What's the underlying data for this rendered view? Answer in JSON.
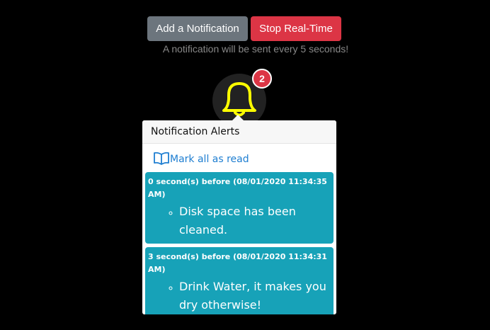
{
  "toolbar": {
    "add_label": "Add a Notification",
    "stop_label": "Stop Real-Time",
    "hint": "A notification will be sent every 5 seconds!"
  },
  "bell": {
    "icon": "bell-icon",
    "badge_count": "2",
    "colors": {
      "bell": "#ffff00",
      "badge": "#dc3545"
    }
  },
  "panel": {
    "title": "Notification Alerts",
    "mark_all_label": "Mark all as read",
    "mark_all_icon": "open-book-icon",
    "notifications": [
      {
        "time": "0 second(s) before (08/01/2020 11:34:35 AM)",
        "message": "Disk space has been cleaned."
      },
      {
        "time": "3 second(s) before (08/01/2020 11:34:31 AM)",
        "message": "Drink Water, it makes you dry otherwise!"
      }
    ],
    "colors": {
      "notification_bg": "#17a2b8",
      "link": "#1e7ed1"
    }
  }
}
